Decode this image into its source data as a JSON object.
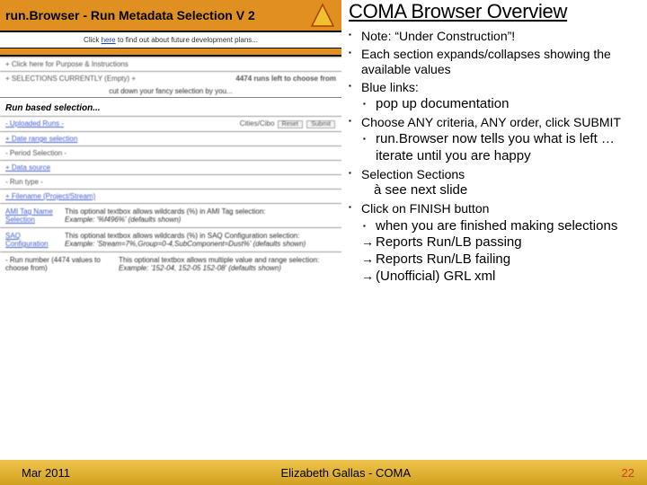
{
  "banner": {
    "title": "run.Browser - Run Metadata Selection V 2",
    "sub_pre": "Click ",
    "sub_link": "here",
    "sub_post": " to find out about future development plans..."
  },
  "left": {
    "instr": "+ Click here for Purpose & Instructions",
    "empty": "+ SELECTIONS CURRENTLY (Empty) +",
    "runsleft": "4474 runs left to choose from",
    "cutdown": "cut down your fancy selection by you...",
    "runbased": "Run based selection...",
    "uploaded": "- Uploaded Runs -",
    "cities": "Cities/Cibo",
    "reset": "Reset",
    "submit": "Submit",
    "daterange": "+ Date range selection",
    "period": "- Period Selection -",
    "datasource": "+ Data source",
    "runtype": "- Run type -",
    "filename": "+ Filename (Project/Stream)",
    "ami": "AMI Tag Name",
    "amidesc": "This optional textbox allows wildcards (%) in AMI Tag selection:",
    "amidesc2": "Example: '%f496%' (defaults shown)",
    "selection": "Selection",
    "saq": "SAQ",
    "config": "Configuration",
    "saqdesc": "This optional textbox allows wildcards (%) in SAQ Configuration selection:",
    "saqdesc2": "Example: 'Stream=7%,Group=0-4,SubComponent=Dust%'  (defaults shown)",
    "runnum1": "- Run number (4474 values to",
    "runnum2": "choose from)",
    "runnumdesc": "This optional textbox allows multiple value and range selection:",
    "runnumdesc2": "Example: '152-04, 152-05 152-08'  (defaults shown)"
  },
  "title": "COMA Browser Overview",
  "b1": "Note: “Under Construction”!",
  "b2": "Each section expands/collapses showing the available values",
  "b3": "Blue links:",
  "b3a": "pop up documentation",
  "b4": "Choose ANY criteria, ANY order, click SUBMIT",
  "b4a": "run.Browser now tells you what is left … iterate until you are happy",
  "b5": "Selection Sections",
  "b5a": "à see next slide",
  "b6": "Click on FINISH button",
  "b6a": "when you are finished making selections",
  "b6b": "Reports Run/LB passing",
  "b6c": "Reports Run/LB failing",
  "b6d": "(Unofficial) GRL xml",
  "footer": {
    "date": "Mar 2011",
    "center": "Elizabeth Gallas - COMA",
    "page": "22"
  }
}
